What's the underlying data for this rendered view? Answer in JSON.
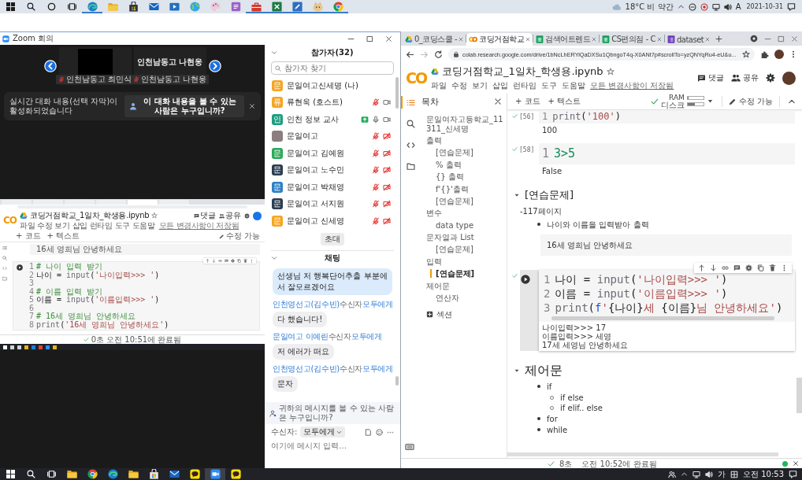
{
  "top_taskbar": {
    "apps": [
      {
        "kind": "start",
        "running": false
      },
      {
        "kind": "search",
        "running": false
      },
      {
        "kind": "ring",
        "running": false
      },
      {
        "kind": "taskview",
        "running": false
      },
      {
        "kind": "edge",
        "running": true
      },
      {
        "kind": "folder",
        "running": false
      },
      {
        "kind": "store",
        "running": false
      },
      {
        "kind": "mail",
        "running": false
      },
      {
        "kind": "film",
        "running": false
      },
      {
        "kind": "globe",
        "running": false
      },
      {
        "kind": "paint",
        "running": false
      },
      {
        "kind": "notes",
        "running": false
      },
      {
        "kind": "toolbox",
        "running": true
      },
      {
        "kind": "sheet",
        "running": true
      },
      {
        "kind": "pen",
        "running": true
      },
      {
        "kind": "mascot",
        "running": true
      },
      {
        "kind": "chrome",
        "running": true
      }
    ],
    "weather": "18°C 비 약간",
    "ime": "A",
    "date": "2021-10-31"
  },
  "zoom": {
    "title": "Zoom 회의",
    "video_tiles": [
      {
        "kind": "camera",
        "label": "인천남동고 최민식",
        "muted": true
      },
      {
        "kind": "name_only",
        "display_name": "인천남동고 나현웅",
        "label": "인천남동고 나현웅",
        "muted": true
      }
    ],
    "caption_banner": {
      "message": "실시간 대화 내용(선택 자막)이 활성화되었습니다",
      "button": "이 대화 내용을 볼 수 있는 사람은 누구입니까?"
    },
    "shared_screen": {
      "logo": "CO",
      "notebook_title": "코딩거점학교_1일차_학생용.ipynb",
      "menu": [
        "파일",
        "수정",
        "보기",
        "삽입",
        "런타임",
        "도구",
        "도움말"
      ],
      "save_status": "모든 변경사항이 저장됨",
      "actions": [
        {
          "kind": "comment",
          "label": "댓글"
        },
        {
          "kind": "share",
          "label": "공유"
        }
      ],
      "toolbar": [
        "+ 코드",
        "+ 텍스트"
      ],
      "edit_mode": "수정 가능",
      "text_cell": "16세 영희님 안녕하세요",
      "code_lines": [
        {
          "n": "1",
          "tokens": [
            {
              "kind": "comment",
              "text": "# 나이 입력 받기"
            }
          ]
        },
        {
          "n": "2",
          "tokens": [
            {
              "kind": "plain",
              "text": "나이 = "
            },
            {
              "kind": "builtin",
              "text": "input"
            },
            {
              "kind": "plain",
              "text": "("
            },
            {
              "kind": "string",
              "text": "'나이입력>>> '"
            },
            {
              "kind": "plain",
              "text": ")"
            }
          ]
        },
        {
          "n": "3"
        },
        {
          "n": "4",
          "tokens": [
            {
              "kind": "comment",
              "text": "# 이름 입력 받기"
            }
          ]
        },
        {
          "n": "5",
          "tokens": [
            {
              "kind": "plain",
              "text": "이름 = "
            },
            {
              "kind": "builtin",
              "text": "input"
            },
            {
              "kind": "plain",
              "text": "("
            },
            {
              "kind": "string",
              "text": "'이름입력>>> '"
            },
            {
              "kind": "plain",
              "text": ")"
            }
          ]
        },
        {
          "n": "6"
        },
        {
          "n": "7",
          "tokens": [
            {
              "kind": "comment",
              "text": "# 16세 영희님 안녕하세요"
            }
          ]
        },
        {
          "n": "8",
          "tokens": [
            {
              "kind": "builtin",
              "text": "print"
            },
            {
              "kind": "plain",
              "text": "("
            },
            {
              "kind": "string",
              "text": "'16세 영희님 안녕하세요'"
            },
            {
              "kind": "plain",
              "text": ")"
            }
          ]
        }
      ],
      "status": "0초 오전 10:51에 완료됨"
    },
    "participants": {
      "title": "참가자(32)",
      "search_placeholder": "참가자 찾기",
      "items": [
        {
          "kind": "self",
          "initial": "문",
          "color": "#f5a524",
          "name": "문일여고신세명 (나)",
          "sharing": false
        },
        {
          "kind": "other",
          "initial": "류",
          "color": "#f5a524",
          "name": "류현욱 (호스트)",
          "sharing": false,
          "muted": true,
          "video_on": true
        },
        {
          "kind": "other",
          "initial": "인",
          "color": "#1f9e80",
          "name": "인천 정보 교사",
          "sharing": true,
          "muted": false,
          "video_on": true
        },
        {
          "kind": "other",
          "name": "문일여고",
          "sharing": false,
          "muted": true,
          "video_on": false
        },
        {
          "kind": "other",
          "initial": "문",
          "color": "#2fa85a",
          "name": "문일여고 김예원",
          "sharing": false,
          "muted": true,
          "video_on": false
        },
        {
          "kind": "other",
          "initial": "문",
          "color": "#2c3d52",
          "name": "문일여고 노수민",
          "sharing": false,
          "muted": true,
          "video_on": false
        },
        {
          "kind": "other",
          "initial": "문",
          "color": "#2f7fc6",
          "name": "문일여고 박채영",
          "sharing": false,
          "muted": true,
          "video_on": false
        },
        {
          "kind": "other",
          "initial": "문",
          "color": "#2c3d52",
          "name": "문일여고 서지원",
          "sharing": false,
          "muted": true,
          "video_on": false
        },
        {
          "kind": "other",
          "initial": "문",
          "color": "#f5a524",
          "name": "문일여고 신세영",
          "sharing": false,
          "muted": true,
          "video_on": false
        }
      ],
      "invite": "초대"
    },
    "chat": {
      "title": "채팅",
      "messages": [
        {
          "kind": "own",
          "text": "선생님 저 행복단어추출 부분에서 잘모르겠어요"
        },
        {
          "kind": "header",
          "sender": "인천영선고(김수빈)",
          "to_label": "수신자",
          "to": "모두에게"
        },
        {
          "kind": "message",
          "text": "다 했습니다!"
        },
        {
          "kind": "header",
          "sender": "문일여고 이예린",
          "to_label": "수신자",
          "to": "모두에게"
        },
        {
          "kind": "message",
          "text": "저 에러가 떠요"
        },
        {
          "kind": "header",
          "sender": "인천영선고(김수빈)",
          "to_label": "수신자",
          "to": "모두에게"
        },
        {
          "kind": "message",
          "text": "문자"
        }
      ],
      "privacy_note": "귀하의 메시지를 볼 수 있는 사람은 누구입니까?",
      "recipient_label": "수신자:",
      "recipient": "모두에게",
      "input_placeholder": "여기에 메시지 입력..."
    }
  },
  "browser": {
    "tabs": [
      {
        "kind": "drive",
        "title": "0_코딩스쿨 -",
        "selected": false
      },
      {
        "kind": "colab",
        "title": "코딩거점학교",
        "selected": true
      },
      {
        "kind": "sheets",
        "title": "검색어트렌드",
        "selected": false
      },
      {
        "kind": "sheets",
        "title": "CS편의점 - C",
        "selected": false
      },
      {
        "kind": "forms",
        "title": "dataset",
        "selected": false
      }
    ],
    "url": "colab.research.google.com/drive/1bNcLhERYiQaDXSu1QbngoT4q-X0ANt7p#scrollTo=yzQNYqRu4-eU&u..."
  },
  "colab": {
    "logo": "CO",
    "notebook_title": "코딩거점학교_1일차_학생용.ipynb",
    "menu": [
      "파일",
      "수정",
      "보기",
      "삽입",
      "런타임",
      "도구",
      "도움말"
    ],
    "save_status": "모든 변경사항이 저장됨",
    "actions": [
      {
        "kind": "comment",
        "label": "댓글"
      },
      {
        "kind": "share",
        "label": "공유"
      }
    ],
    "toolbar": [
      "+ 코드",
      "+ 텍스트"
    ],
    "ram": {
      "label": "RAM",
      "level": 0.08
    },
    "disk": {
      "label": "디스크",
      "level": 0.45
    },
    "edit_mode": "수정 가능",
    "rail": [
      {
        "kind": "toc",
        "selected": true
      },
      {
        "kind": "search",
        "selected": false
      },
      {
        "kind": "code",
        "selected": false
      },
      {
        "kind": "files",
        "selected": false
      }
    ],
    "toc": {
      "title": "목차",
      "items": [
        {
          "title": "문일여자고등학교_11311_신세명",
          "selected": false
        },
        {
          "title": "출력",
          "selected": false,
          "children": [
            {
              "title": "[연습문제]",
              "selected": false
            },
            {
              "title": "% 출력",
              "selected": false
            },
            {
              "title": "{} 출력",
              "selected": false
            },
            {
              "title": "f'{}'출력",
              "selected": false
            },
            {
              "title": "[연습문제]",
              "selected": false
            }
          ]
        },
        {
          "title": "변수",
          "selected": false,
          "children": [
            {
              "title": "data type",
              "selected": false
            }
          ]
        },
        {
          "title": "문자열과 List",
          "selected": false,
          "children": [
            {
              "title": "[연습문제]",
              "selected": false
            }
          ]
        },
        {
          "title": "입력",
          "selected": false,
          "children": [
            {
              "title": "[연습문제]",
              "selected": true
            }
          ]
        },
        {
          "title": "제어문",
          "selected": false,
          "children": [
            {
              "title": "연산자",
              "selected": false
            }
          ]
        }
      ],
      "add_section": "섹션"
    },
    "cells": [
      {
        "kind": "code",
        "active": false,
        "ran": true,
        "count": "[56]",
        "lines": [
          {
            "n": "1",
            "tokens": [
              {
                "kind": "builtin",
                "text": "print"
              },
              {
                "kind": "plain",
                "text": "("
              },
              {
                "kind": "string",
                "text": "'100'"
              },
              {
                "kind": "plain",
                "text": ")"
              }
            ]
          }
        ],
        "output": [
          "100"
        ]
      },
      {
        "kind": "code",
        "active": false,
        "ran": true,
        "count": "[58]",
        "lines": [
          {
            "n": "1",
            "tokens": [
              {
                "kind": "number",
                "text": "3>5"
              }
            ]
          }
        ],
        "output": [
          "False"
        ]
      },
      {
        "kind": "subsection",
        "text": "[연습문제]",
        "expanded": true
      },
      {
        "kind": "text",
        "paragraph": "-117페이지",
        "bullets": [
          {
            "text": "나이와 이름을 입력받아 출력"
          }
        ]
      },
      {
        "kind": "quote",
        "text": "16세 영희님 안녕하세요"
      },
      {
        "kind": "code",
        "active": true,
        "ran": true,
        "lines": [
          {
            "n": "1",
            "tokens": [
              {
                "kind": "plain",
                "text": "나이 = "
              },
              {
                "kind": "builtin",
                "text": "input"
              },
              {
                "kind": "plain",
                "text": "("
              },
              {
                "kind": "string",
                "text": "'나이입력>>> '"
              },
              {
                "kind": "plain",
                "text": ")"
              }
            ]
          },
          {
            "n": "2",
            "tokens": [
              {
                "kind": "plain",
                "text": "이름 = "
              },
              {
                "kind": "builtin",
                "text": "input"
              },
              {
                "kind": "plain",
                "text": "("
              },
              {
                "kind": "string",
                "text": "'이름입력>>> '"
              },
              {
                "kind": "plain",
                "text": ")"
              }
            ]
          },
          {
            "n": "3",
            "tokens": [
              {
                "kind": "builtin",
                "text": "print"
              },
              {
                "kind": "plain",
                "text": "("
              },
              {
                "kind": "keyword",
                "text": "f"
              },
              {
                "kind": "string",
                "text": "'"
              },
              {
                "kind": "plain",
                "text": "{나이}"
              },
              {
                "kind": "string",
                "text": "세 "
              },
              {
                "kind": "plain",
                "text": "{이름}"
              },
              {
                "kind": "string",
                "text": "님 안녕하세요'"
              },
              {
                "kind": "plain",
                "text": ")"
              }
            ]
          }
        ],
        "output": [
          "나이입력>>> 17",
          "이름입력>>> 세영",
          "17세 세영님 안녕하세요"
        ]
      },
      {
        "kind": "section",
        "text": "제어문",
        "expanded": true
      },
      {
        "kind": "text",
        "bullets": [
          {
            "text": "if",
            "children": [
              {
                "text": "if else"
              },
              {
                "text": "if elif.. else"
              }
            ]
          },
          {
            "text": "for"
          },
          {
            "text": "while"
          }
        ]
      }
    ],
    "status": {
      "duration": "8초",
      "message": "오전 10:52에 완료됨",
      "connected": true
    }
  },
  "bottom_taskbar": {
    "apps": [
      {
        "kind": "start",
        "active": false
      },
      {
        "kind": "search",
        "active": false
      },
      {
        "kind": "taskview",
        "active": false
      },
      {
        "kind": "folder",
        "active": false
      },
      {
        "kind": "chrome",
        "active": false
      },
      {
        "kind": "edge",
        "active": false
      },
      {
        "kind": "folder",
        "active": false
      },
      {
        "kind": "store",
        "active": false
      },
      {
        "kind": "mail",
        "active": false
      },
      {
        "kind": "talk",
        "active": false
      },
      {
        "kind": "zoom",
        "active": true
      },
      {
        "kind": "talk",
        "active": false
      }
    ],
    "ime": "가",
    "time": "오전 10:53"
  }
}
